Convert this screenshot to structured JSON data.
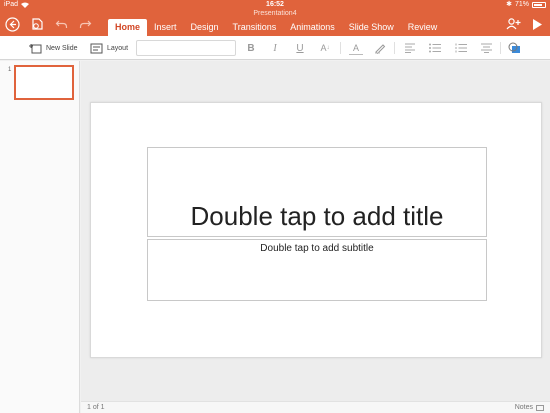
{
  "status_bar": {
    "device": "iPad",
    "time": "16:52",
    "battery": "71%"
  },
  "document": {
    "title": "Presentation4"
  },
  "ribbon": {
    "tabs": [
      {
        "label": "Home",
        "active": true
      },
      {
        "label": "Insert",
        "active": false
      },
      {
        "label": "Design",
        "active": false
      },
      {
        "label": "Transitions",
        "active": false
      },
      {
        "label": "Animations",
        "active": false
      },
      {
        "label": "Slide Show",
        "active": false
      },
      {
        "label": "Review",
        "active": false
      }
    ]
  },
  "toolbar": {
    "new_slide_label": "New Slide",
    "layout_label": "Layout",
    "font_value": "",
    "format_icons": [
      "bold-icon",
      "italic-icon",
      "underline-icon",
      "font-size-icon",
      "font-color-icon",
      "highlight-icon",
      "align-left-icon",
      "bullets-icon",
      "numbering-icon",
      "align-center-icon",
      "shapes-icon"
    ]
  },
  "thumbnails": [
    {
      "number": "1"
    }
  ],
  "slide": {
    "title_placeholder": "Double tap to add title",
    "subtitle_placeholder": "Double tap to add subtitle"
  },
  "footer": {
    "slide_count": "1 of 1",
    "notes_label": "Notes"
  },
  "colors": {
    "accent": "#e0633c",
    "tab_active_text": "#d24726"
  }
}
